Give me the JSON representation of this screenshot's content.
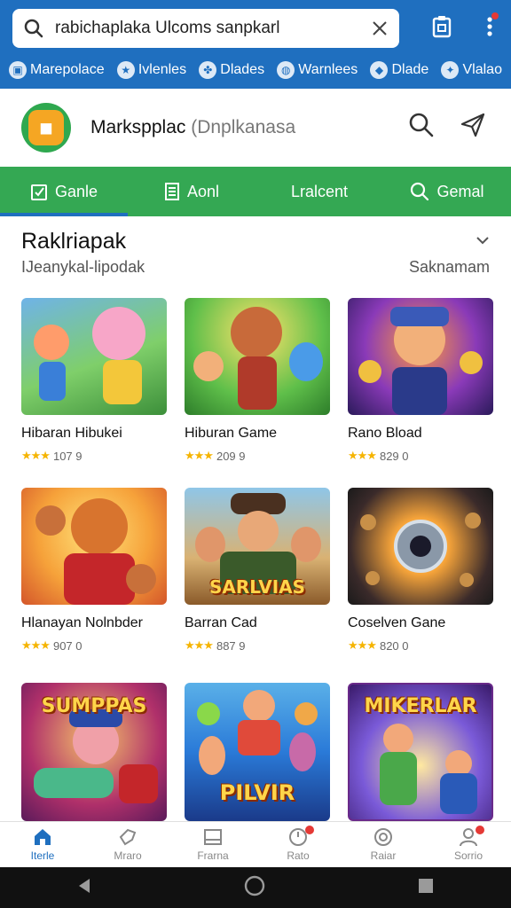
{
  "search": {
    "value": "rabichaplaka Ulcoms sanpkarl"
  },
  "categories": [
    {
      "label": "Marepolace",
      "icon": "store-icon"
    },
    {
      "label": "Ivlenles",
      "icon": "star-icon"
    },
    {
      "label": "Dlades",
      "icon": "leaf-icon"
    },
    {
      "label": "Warnlees",
      "icon": "globe-icon"
    },
    {
      "label": "Dlade",
      "icon": "tag-icon"
    },
    {
      "label": "Vlalao",
      "icon": "compass-icon"
    }
  ],
  "app": {
    "name": "Markspplac",
    "subtitle": "(Dnplkanasa"
  },
  "tabs": [
    {
      "label": "Ganle",
      "icon": "clipboard-icon"
    },
    {
      "label": "Aonl",
      "icon": "document-icon"
    },
    {
      "label": "Lralcent",
      "icon": ""
    },
    {
      "label": "Gemal",
      "icon": "search-icon"
    }
  ],
  "section": {
    "title": "Raklriapak",
    "subtitle": "IJeanykal-lipodak",
    "link": "Saknamam"
  },
  "cards": [
    {
      "title": "Hibaran Hibukei",
      "rating": "107 9",
      "banner": ""
    },
    {
      "title": "Hiburan Game",
      "rating": "209 9",
      "banner": ""
    },
    {
      "title": "Rano Bload",
      "rating": "829 0",
      "banner": ""
    },
    {
      "title": "Hlanayan Nolnbder",
      "rating": "907 0",
      "banner": ""
    },
    {
      "title": "Barran Cad",
      "rating": "887 9",
      "banner": "SARLVIAS"
    },
    {
      "title": "Coselven Gane",
      "rating": "820 0",
      "banner": ""
    },
    {
      "title": "",
      "rating": "",
      "banner": "SUMPPAS"
    },
    {
      "title": "",
      "rating": "",
      "banner": "PILVIR"
    },
    {
      "title": "",
      "rating": "",
      "banner": "MIKERLAR"
    }
  ],
  "nav": [
    {
      "label": "Iterle"
    },
    {
      "label": "Mraro"
    },
    {
      "label": "Frarna"
    },
    {
      "label": "Rato"
    },
    {
      "label": "Raiar"
    },
    {
      "label": "Sorrio"
    }
  ],
  "colors": {
    "primary": "#1f6fbf",
    "green": "#34a853",
    "star": "#f5b400",
    "badge": "#e53935"
  }
}
